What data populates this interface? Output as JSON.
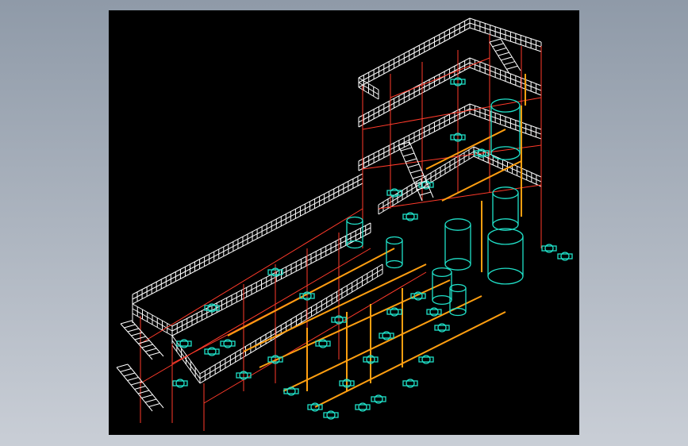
{
  "viewer": {
    "background": "#000000",
    "frame_color": "#ff3a2a",
    "railing_color": "#ffffff",
    "pipe_color": "#ff9f10",
    "equipment_color": "#20e0c8"
  }
}
